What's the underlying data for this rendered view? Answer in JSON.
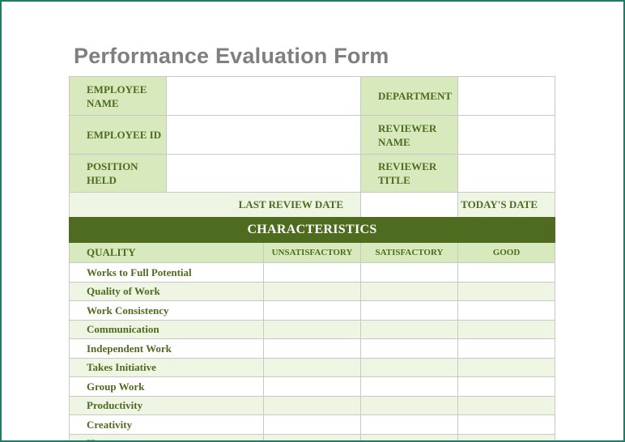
{
  "form": {
    "title": "Performance Evaluation Form",
    "employee_name_label": "EMPLOYEE NAME",
    "employee_id_label": "EMPLOYEE ID",
    "position_held_label": "POSITION HELD",
    "department_label": "DEPARTMENT",
    "reviewer_name_label": "REVIEWER NAME",
    "reviewer_title_label": "REVIEWER TITLE",
    "last_review_date_label": "LAST REVIEW DATE",
    "todays_date_label": "TODAY'S DATE"
  },
  "characteristics": {
    "section_title": "CHARACTERISTICS",
    "columns": [
      "QUALITY",
      "UNSATISFACTORY",
      "SATISFACTORY",
      "GOOD"
    ],
    "items": [
      "Works to Full Potential",
      "Quality of Work",
      "Work Consistency",
      "Communication",
      "Independent Work",
      "Takes Initiative",
      "Group Work",
      "Productivity",
      "Creativity",
      "H"
    ]
  },
  "colors": {
    "header_green": "#4e6b1f",
    "label_green": "#d7e9bd",
    "light_green": "#eef5e3",
    "title_gray": "#7f7f7f",
    "frame_teal": "#1f7a68"
  }
}
